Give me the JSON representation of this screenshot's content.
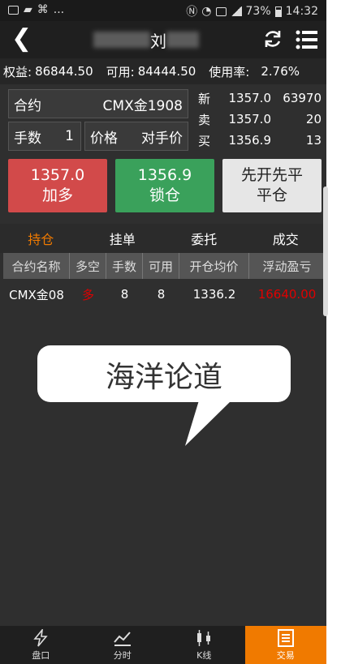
{
  "status_bar": {
    "left_more": "...",
    "battery": "73%",
    "time": "14:32"
  },
  "title_bar": {
    "title_visible": "刘"
  },
  "account": {
    "equity_label": "权益:",
    "equity_value": "86844.50",
    "available_label": "可用:",
    "available_value": "84444.50",
    "usage_label": "使用率:",
    "usage_value": "2.76%"
  },
  "order": {
    "contract_label": "合约",
    "contract_value": "CMX金1908",
    "hands_label": "手数",
    "hands_value": "1",
    "price_label": "价格",
    "price_value": "对手价"
  },
  "quote": {
    "rows": [
      {
        "label": "新",
        "price": "1357.0",
        "volume": "63970"
      },
      {
        "label": "卖",
        "price": "1357.0",
        "volume": "20"
      },
      {
        "label": "买",
        "price": "1356.9",
        "volume": "13"
      }
    ]
  },
  "buttons": {
    "buy_price": "1357.0",
    "buy_label": "加多",
    "lock_price": "1356.9",
    "lock_label": "锁仓",
    "close_title": "先开先平",
    "close_label": "平仓"
  },
  "tabs": [
    "持仓",
    "挂单",
    "委托",
    "成交"
  ],
  "table": {
    "headers": [
      "合约名称",
      "多空",
      "手数",
      "可用",
      "开仓均价",
      "浮动盈亏"
    ],
    "rows": [
      {
        "name": "CMX金08",
        "side": "多",
        "hands": "8",
        "available": "8",
        "avg_price": "1336.2",
        "pnl": "16640.00"
      }
    ]
  },
  "watermark": {
    "text": "海洋论道"
  },
  "bottom_nav": [
    "盘口",
    "分时",
    "K线",
    "交易"
  ],
  "colors": {
    "accent": "#f07a00",
    "buy": "#d24a4a",
    "lock": "#3aa15b",
    "loss_red": "#e00000"
  }
}
